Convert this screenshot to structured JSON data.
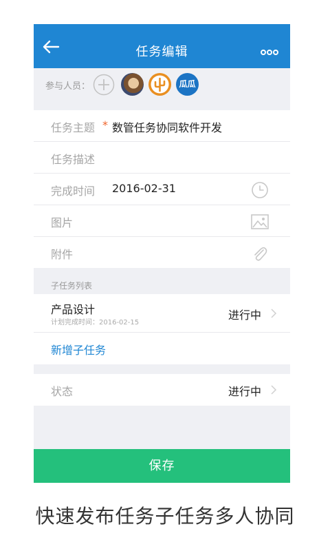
{
  "header": {
    "title": "任务编辑"
  },
  "members": {
    "label": "参与人员：",
    "avatar3_text": "瓜瓜"
  },
  "form": {
    "subject": {
      "label": "任务主题",
      "required": "*",
      "value": "数管任务协同软件开发"
    },
    "description": {
      "label": "任务描述",
      "value": ""
    },
    "finish_time": {
      "label": "完成时间",
      "value": "2016-02-31"
    },
    "images": {
      "label": "图片"
    },
    "attachments": {
      "label": "附件"
    }
  },
  "subtasks": {
    "header": "子任务列表",
    "items": [
      {
        "name": "产品设计",
        "plan_date": "计划完成时间：2016-02-15",
        "status": "进行中"
      }
    ],
    "add_label": "新增子任务"
  },
  "status": {
    "label": "状态",
    "value": "进行中"
  },
  "save_label": "保存",
  "caption": "快速发布任务子任务多人协同",
  "colors": {
    "primary": "#1f86d3",
    "save": "#24c07c",
    "required": "#f0652c",
    "background": "#eff0f4"
  },
  "icons": [
    "back-arrow-icon",
    "more-dots-icon",
    "add-member-icon",
    "clock-icon",
    "image-icon",
    "paperclip-icon",
    "chevron-right-icon"
  ]
}
